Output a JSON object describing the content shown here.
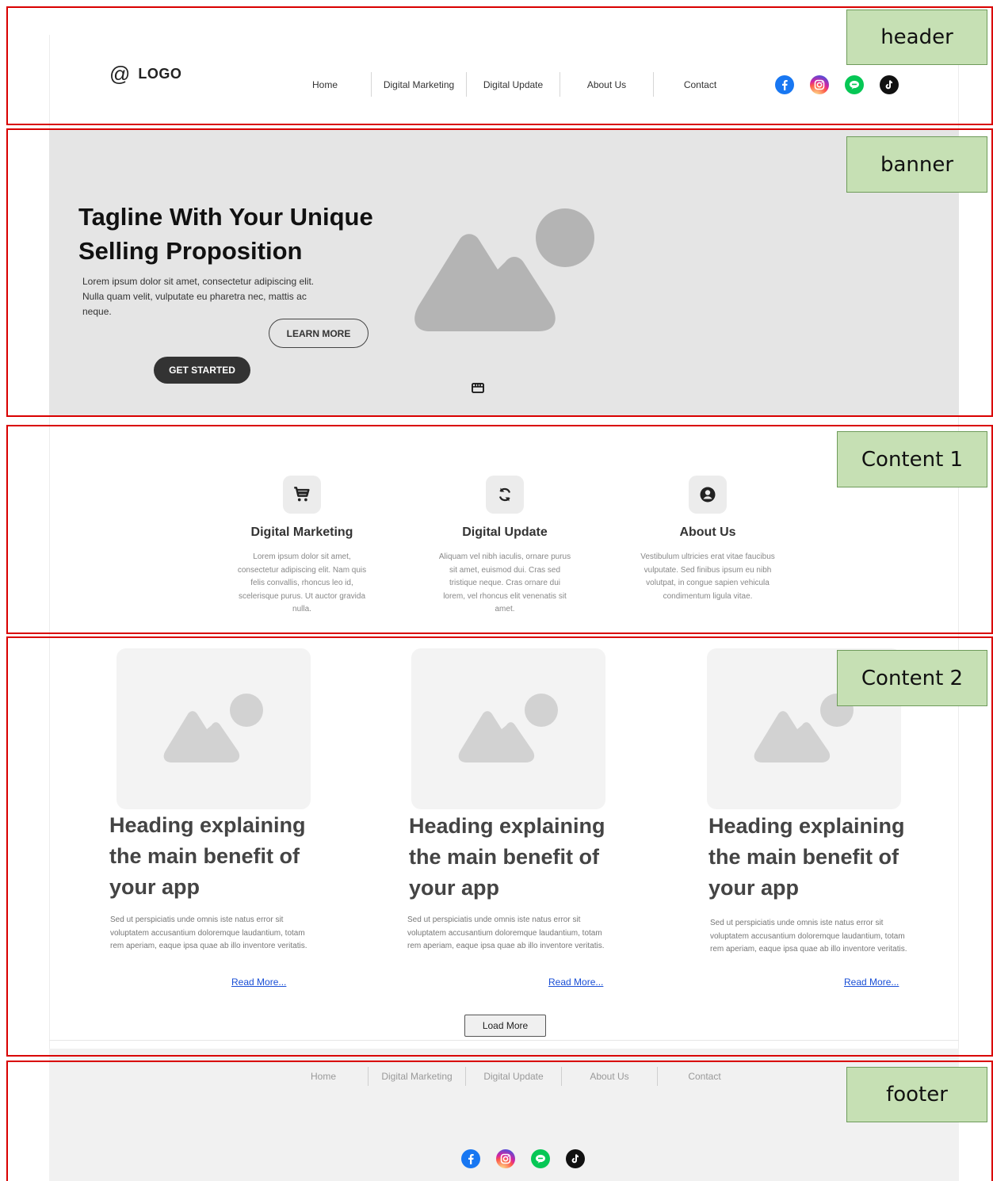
{
  "labels": {
    "header": "header",
    "banner": "banner",
    "content1": "Content 1",
    "content2": "Content 2",
    "footer": "footer"
  },
  "header": {
    "logo_symbol": "@",
    "logo_text": "LOGO",
    "nav": [
      "Home",
      "Digital Marketing",
      "Digital Update",
      "About Us",
      "Contact"
    ],
    "social_icons": [
      "facebook-icon",
      "instagram-icon",
      "line-icon",
      "tiktok-icon"
    ]
  },
  "banner": {
    "tagline": "Tagline With Your Unique Selling Proposition",
    "text": "Lorem ipsum dolor sit amet, consectetur adipiscing elit. Nulla quam velit, vulputate eu pharetra nec, mattis ac neque.",
    "learn_more": "LEARN MORE",
    "get_started": "GET STARTED",
    "background_color": "#e5e5e5"
  },
  "content1": {
    "features": [
      {
        "icon": "cart-icon",
        "title": "Digital Marketing",
        "text": "Lorem ipsum dolor sit amet, consectetur adipiscing elit. Nam quis felis convallis, rhoncus leo id, scelerisque purus. Ut auctor gravida nulla."
      },
      {
        "icon": "refresh-icon",
        "title": "Digital Update",
        "text": "Aliquam vel nibh iaculis, ornare purus sit amet, euismod dui. Cras sed tristique neque. Cras ornare dui lorem, vel rhoncus elit venenatis sit amet."
      },
      {
        "icon": "user-circle-icon",
        "title": "About Us",
        "text": "Vestibulum ultricies erat vitae faucibus vulputate. Sed finibus ipsum eu nibh volutpat, in congue sapien vehicula condimentum ligula vitae."
      }
    ]
  },
  "content2": {
    "cards": [
      {
        "heading": "Heading explaining the main benefit of your app",
        "text": "Sed ut perspiciatis unde omnis iste natus error sit voluptatem accusantium doloremque laudantium, totam rem aperiam, eaque ipsa quae ab illo inventore veritatis.",
        "link": "Read More..."
      },
      {
        "heading": "Heading explaining the main benefit of your app",
        "text": "Sed ut perspiciatis unde omnis iste natus error sit voluptatem accusantium doloremque laudantium, totam rem aperiam, eaque ipsa quae ab illo inventore veritatis.",
        "link": "Read More..."
      },
      {
        "heading": "Heading explaining the main benefit of your app",
        "text": "Sed ut perspiciatis unde omnis iste natus error sit voluptatem accusantium doloremque laudantium, totam rem aperiam, eaque ipsa quae ab illo inventore veritatis.",
        "link": "Read More..."
      }
    ],
    "load_more": "Load More"
  },
  "footer": {
    "nav": [
      "Home",
      "Digital Marketing",
      "Digital Update",
      "About Us",
      "Contact"
    ],
    "social_icons": [
      "facebook-icon",
      "instagram-icon",
      "line-icon",
      "tiktok-icon"
    ]
  },
  "colors": {
    "frame": "#d90000",
    "tag_fill": "#c6e0b4",
    "dark_button": "#333333",
    "link": "#1a4fd6"
  }
}
